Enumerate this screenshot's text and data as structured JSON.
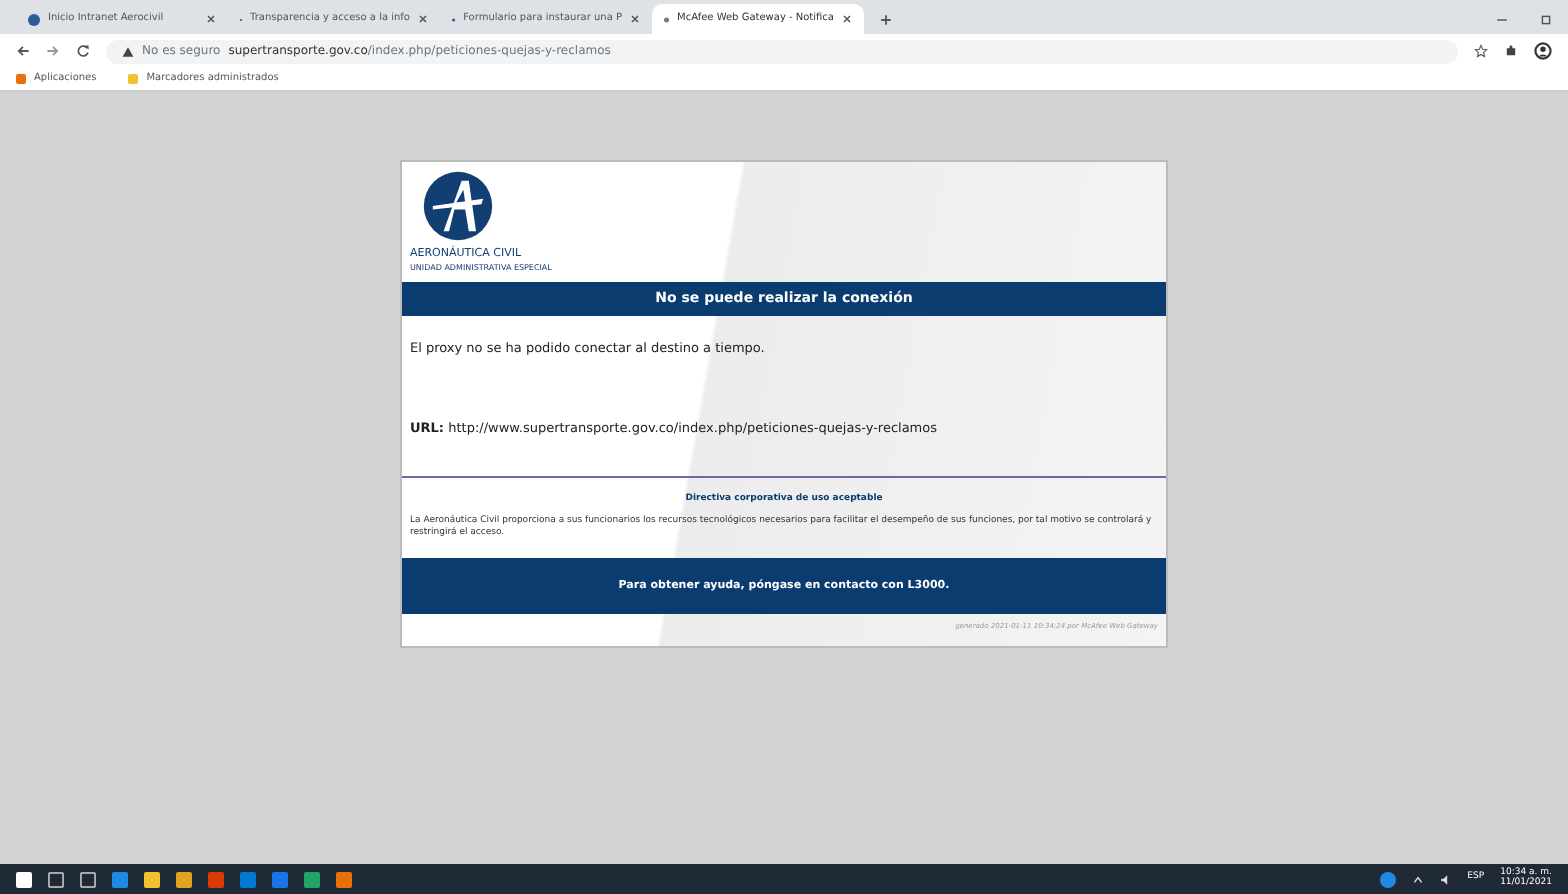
{
  "browser": {
    "tabs": [
      {
        "title": "Inicio Intranet Aerocivil",
        "selected": false
      },
      {
        "title": "Transparencia y acceso a la info",
        "selected": false
      },
      {
        "title": "Formulario para instaurar una P",
        "selected": false
      },
      {
        "title": "McAfee Web Gateway - Notifica",
        "selected": true
      }
    ],
    "security_label": "No es seguro",
    "url_host": "supertransporte.gov.co",
    "url_path": "/index.php/peticiones-quejas-y-reclamos",
    "bookmarks": [
      "Aplicaciones",
      "Marcadores administrados"
    ]
  },
  "page": {
    "logo_name": "AERONÁUTICA CIVIL",
    "logo_subtitle": "UNIDAD ADMINISTRATIVA ESPECIAL",
    "title": "No se puede realizar la conexión",
    "message": "El proxy no se ha podido conectar al destino a tiempo.",
    "url_label": "URL:",
    "url": "http://www.supertransporte.gov.co/index.php/peticiones-quejas-y-reclamos",
    "policy_title": "Directiva corporativa de uso aceptable",
    "policy_text": "La Aeronáutica Civil proporciona a sus funcionarios los recursos tecnológicos necesarios para facilitar el desempeño de sus funciones, por tal motivo se controlará y restringirá el acceso.",
    "help": "Para obtener ayuda, póngase en contacto con L3000.",
    "footer": "generado 2021-01-11 10:34:24 por McAfee Web Gateway"
  },
  "taskbar": {
    "language": "ESP",
    "time": "10:34 a. m.",
    "date": "11/01/2021"
  }
}
